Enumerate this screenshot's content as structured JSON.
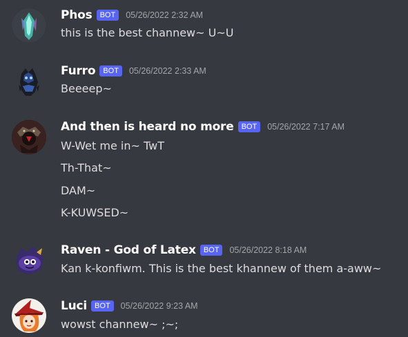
{
  "messages": [
    {
      "username": "Phos",
      "bot_tag": "BOT",
      "timestamp": "05/26/2022 2:32 AM",
      "lines": [
        "this is the best channew~ U~U"
      ],
      "avatar_icon": "crystal-figure-avatar",
      "avatar_color": "#4ac6b7"
    },
    {
      "username": "Furro",
      "bot_tag": "BOT",
      "timestamp": "05/26/2022 2:33 AM",
      "lines": [
        "Beeeep~"
      ],
      "avatar_icon": "dark-creature-avatar",
      "avatar_color": "#2e4a8a"
    },
    {
      "username": "And then is heard no more",
      "bot_tag": "BOT",
      "timestamp": "05/26/2022 7:17 AM",
      "lines": [
        "W-Wet me in~ TwT",
        "Th-That~",
        "DAM~",
        "K-KUWSED~"
      ],
      "avatar_icon": "dark-figure-avatar",
      "avatar_color": "#8a1e22"
    },
    {
      "username": "Raven - God of Latex",
      "bot_tag": "BOT",
      "timestamp": "05/26/2022 8:18 AM",
      "lines": [
        "Kan k-konfiwm. This is the best khannew of them a-aww~"
      ],
      "avatar_icon": "purple-creature-avatar",
      "avatar_color": "#5b3fa3"
    },
    {
      "username": "Luci",
      "bot_tag": "BOT",
      "timestamp": "05/26/2022 9:23 AM",
      "lines": [
        "wowst channew~ ;~;"
      ],
      "avatar_icon": "witch-hat-avatar",
      "avatar_color": "#e87c2a"
    }
  ]
}
